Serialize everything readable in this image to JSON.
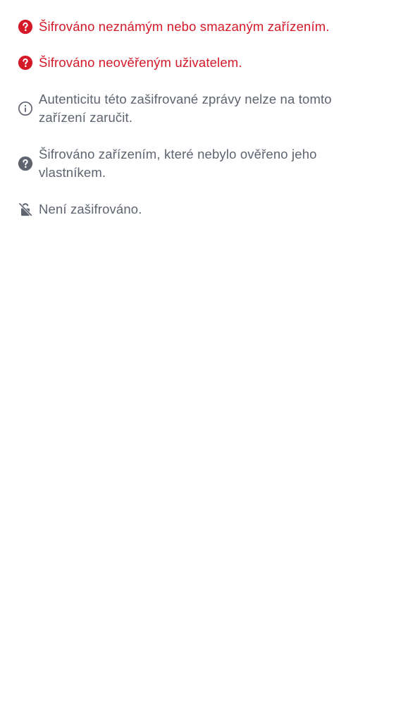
{
  "legend": {
    "items": [
      {
        "icon": "question-circle-icon",
        "text": "Šifrováno neznámým nebo smazaným zařízením.",
        "color": "#d51928"
      },
      {
        "icon": "question-circle-icon",
        "text": "Šifrováno neověřeným uživatelem.",
        "color": "#d51928"
      },
      {
        "icon": "info-circle-icon",
        "text": "Autenticitu této zašifrované zprávy nelze na tomto zařízení zaručit.",
        "color": "#5e6370"
      },
      {
        "icon": "question-circle-icon",
        "text": "Šifrováno zařízením, které nebylo ověřeno jeho vlastníkem.",
        "color": "#5e6370"
      },
      {
        "icon": "lock-off-icon",
        "text": "Není zašifrováno.",
        "color": "#5e6370"
      }
    ]
  }
}
